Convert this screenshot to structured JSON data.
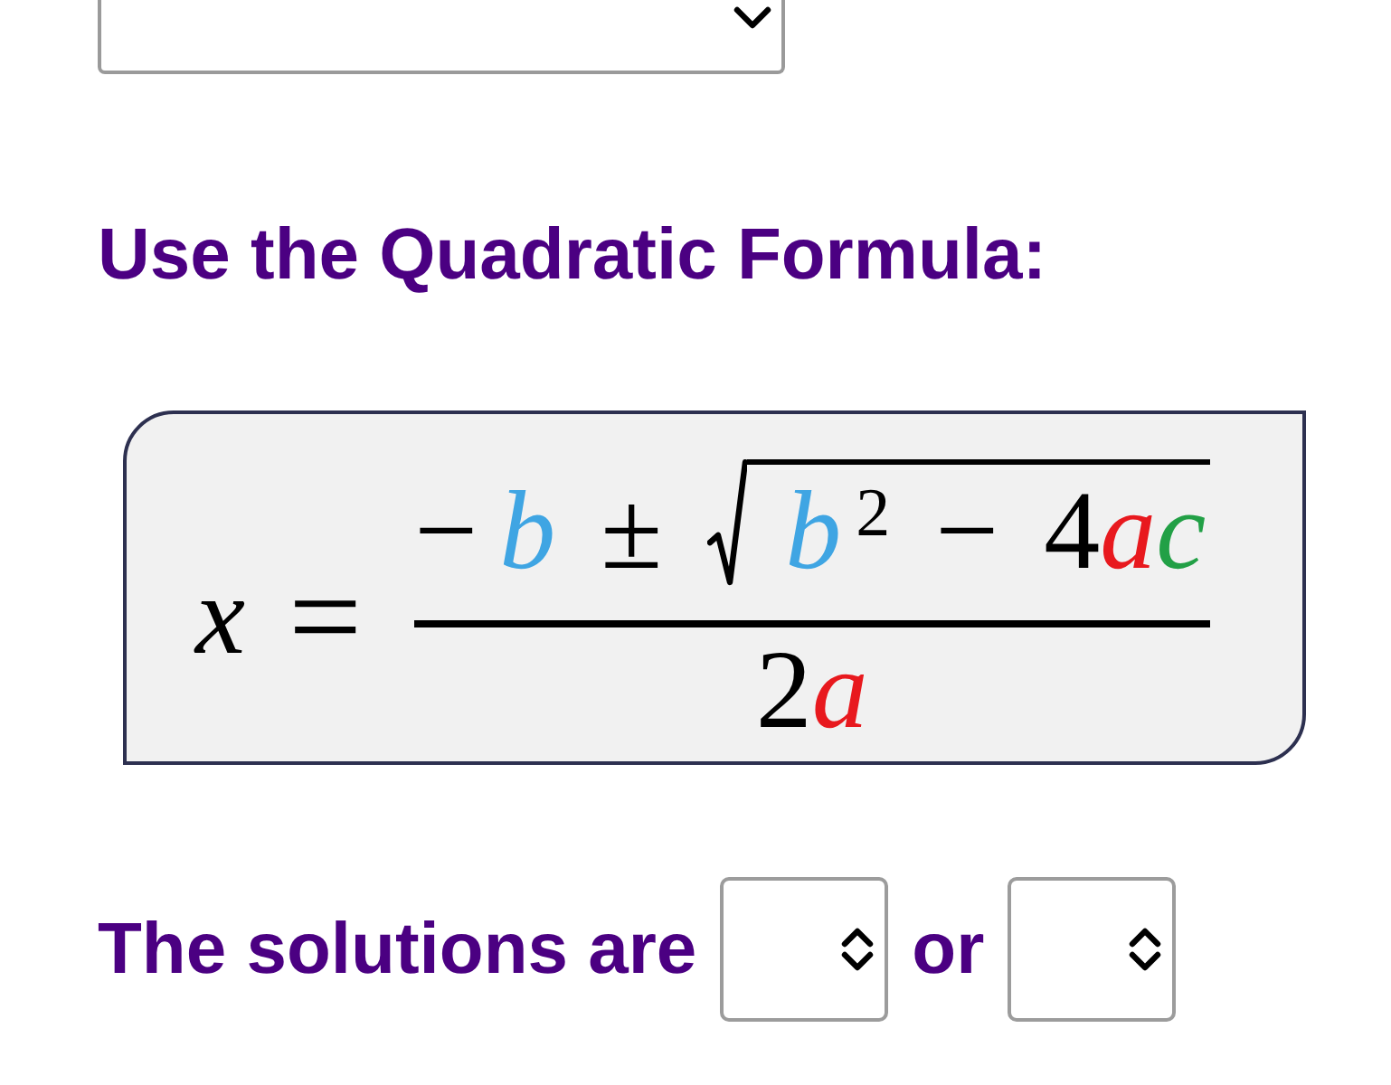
{
  "content": [
    {
      "kind": "dropdown",
      "expanded": false
    },
    {
      "kind": "heading",
      "text": "Use the Quadratic Formula:"
    },
    {
      "kind": "formula",
      "lhs": [
        {
          "kind": "var",
          "text": "x"
        }
      ],
      "relation": "=",
      "numerator": [
        {
          "kind": "op",
          "text": "−"
        },
        {
          "kind": "var",
          "text": "b",
          "color": "#3fa5e3"
        },
        {
          "kind": "op",
          "text": "±"
        },
        {
          "kind": "sqrt",
          "children": [
            {
              "kind": "var",
              "text": "b",
              "color": "#3fa5e3"
            },
            {
              "kind": "sup",
              "text": "2"
            },
            {
              "kind": "op",
              "text": "−"
            },
            {
              "kind": "num",
              "text": "4"
            },
            {
              "kind": "var",
              "text": "a",
              "color": "#e8191e"
            },
            {
              "kind": "var",
              "text": "c",
              "color": "#22a046"
            }
          ]
        }
      ],
      "denominator": [
        {
          "kind": "num",
          "text": "2"
        },
        {
          "kind": "var",
          "text": "a",
          "color": "#e8191e"
        }
      ]
    },
    {
      "kind": "sentence",
      "parts": [
        {
          "kind": "text",
          "text": "The solutions are"
        },
        {
          "kind": "select"
        },
        {
          "kind": "text",
          "text": "or"
        },
        {
          "kind": "select"
        }
      ]
    }
  ]
}
